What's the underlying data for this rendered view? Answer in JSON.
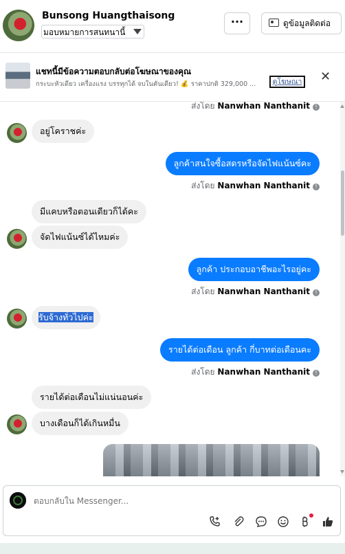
{
  "header": {
    "contact_name": "Bunsong Huangthaisong",
    "assign_label": "มอบหมายการสนทนานี้",
    "more_label": "···",
    "contact_info_label": "ดูข้อมูลติดต่อ"
  },
  "ad_banner": {
    "title": "แชทนี้มีข้อความตอบกลับต่อโฆษณาของคุณ",
    "description": "กระบะหัวเดียว เครื่องแรง บรรทุกได้ จบในคันเดียว! 💰 ราคาปกติ 329,000 ...",
    "view_ad_label": "ดูโฆษณา",
    "close_label": "✕"
  },
  "messages": [
    {
      "type": "sender",
      "prefix": "ส่งโดย",
      "name": "Nanwhan Nanthanit"
    },
    {
      "type": "in",
      "text": "อยู่โคราชค่ะ"
    },
    {
      "type": "out",
      "text": "ลูกค้าสนใจซื้อสดรหรือจัดไฟแน้นซ์คะ"
    },
    {
      "type": "sender",
      "prefix": "ส่งโดย",
      "name": "Nanwhan Nanthanit"
    },
    {
      "type": "in",
      "text": "มีแคบหรือตอนเดียวก็ได้คะ"
    },
    {
      "type": "in",
      "text": "จัดไฟแน้นซ์ได้ไหมค่ะ"
    },
    {
      "type": "out",
      "text": "ลูกค้า ประกอบอาชีพอะไรอยู่คะ"
    },
    {
      "type": "sender",
      "prefix": "ส่งโดย",
      "name": "Nanwhan Nanthanit"
    },
    {
      "type": "in",
      "text": "รับจ้างทั่วไปค่ะ"
    },
    {
      "type": "out",
      "text": "รายได้ต่อเดือน ลูกค้า กี่บาทต่อเดือนคะ"
    },
    {
      "type": "sender",
      "prefix": "ส่งโดย",
      "name": "Nanwhan Nanthanit"
    },
    {
      "type": "in",
      "text": "รายได้ต่อเดือนไม่แน่นอนค่ะ"
    },
    {
      "type": "in",
      "text": "บางเดือนก็ได้เกินหมื่น"
    }
  ],
  "composer": {
    "placeholder": "ตอบกลับใน Messenger...",
    "icons": [
      "call-add-icon",
      "attachment-icon",
      "saved-reply-icon",
      "emoji-icon",
      "payment-icon",
      "thumbs-up-icon"
    ]
  }
}
